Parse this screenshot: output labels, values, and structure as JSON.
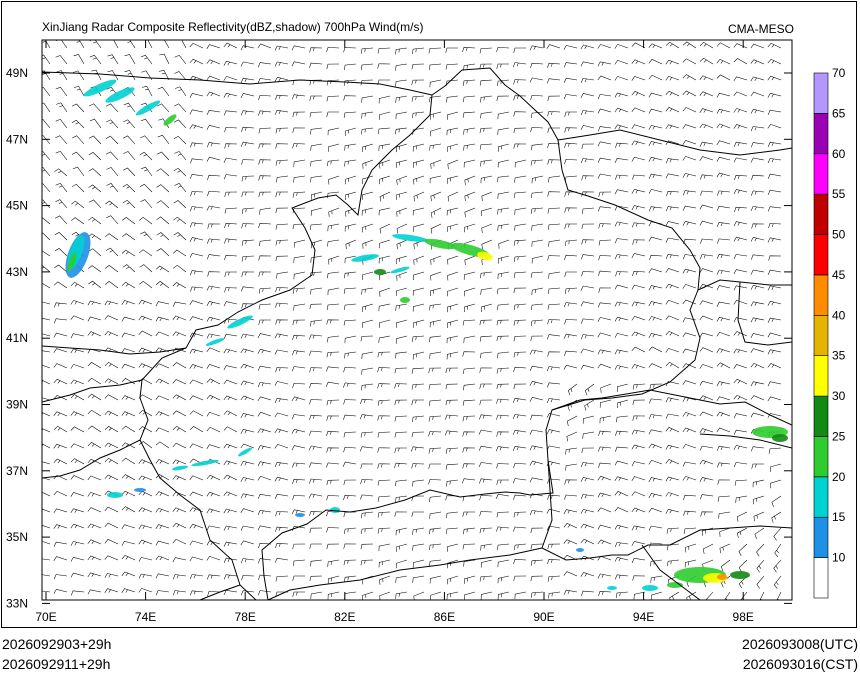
{
  "title": "XinJiang Radar Composite Reflectivity(dBZ,shadow) 700hPa Wind(m/s)",
  "agency": "CMA-MESO",
  "lat_labels": [
    "49N",
    "47N",
    "45N",
    "43N",
    "41N",
    "39N",
    "37N",
    "35N",
    "33N"
  ],
  "lon_labels": [
    "70E",
    "74E",
    "78E",
    "82E",
    "86E",
    "90E",
    "94E",
    "98E"
  ],
  "colorbar": {
    "labels": [
      "10",
      "15",
      "20",
      "25",
      "30",
      "35",
      "40",
      "45",
      "50",
      "55",
      "60",
      "65",
      "70"
    ],
    "colors": [
      "#ffffff",
      "#1e90e6",
      "#00d2d2",
      "#2ecc2e",
      "#138a13",
      "#ffff00",
      "#e6b400",
      "#ff8c00",
      "#ff0000",
      "#c00000",
      "#ff00ff",
      "#9a00b4",
      "#b496ff"
    ]
  },
  "footer": {
    "init_utc": "2026092903+29h",
    "init_cst": "2026092911+29h",
    "valid_utc": "2026093008(UTC)",
    "valid_cst": "2026093016(CST)"
  }
}
